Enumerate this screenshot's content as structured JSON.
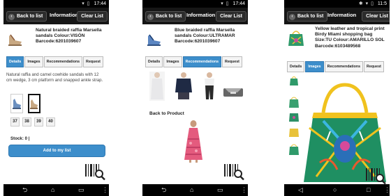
{
  "status_bar": {
    "time_1": "17:44",
    "time_2": "17:44",
    "time_3": "11:5"
  },
  "header": {
    "back_label": "Back to list",
    "title": "Information",
    "clear_label": "Clear List"
  },
  "tabs": {
    "details": "Details",
    "images": "Images",
    "recommendations": "Recommendations",
    "request": "Request"
  },
  "screen_1": {
    "product_lines": [
      "Natural braided raffia Marsella",
      "sandals Colour:VISÓN",
      "Barcode:6201039607"
    ],
    "description": "Natural raffia and camel cowhide sandals with 12 cm wedge, 3 cm platform and snapped ankle strap.",
    "sizes": [
      "37",
      "38",
      "39",
      "40"
    ],
    "stock": "Stock: 0 |",
    "add_button": "Add to my list"
  },
  "screen_2": {
    "product_lines": [
      "Blue braided raffia Marsella",
      "sandals Colour:ULTRAMAR",
      "Barcode:6201039607"
    ],
    "back_to_product": "Back to Product"
  },
  "screen_3": {
    "product_lines": [
      "Yellow leather and tropical print",
      "Birdy Miami shopping bag",
      "Size:TU Colour:AMARILLO SOL",
      "Barcode:6103489568"
    ]
  },
  "colors": {
    "accent_blue": "#3d8ecb",
    "app_bar": "#161616",
    "status_bar": "#000000"
  },
  "icons": [
    "back-chevron-icon",
    "barcode-scanner-icon",
    "nav-back-icon",
    "nav-home-icon",
    "nav-recents-icon",
    "nav-menu-icon",
    "wifi-icon",
    "battery-icon"
  ]
}
